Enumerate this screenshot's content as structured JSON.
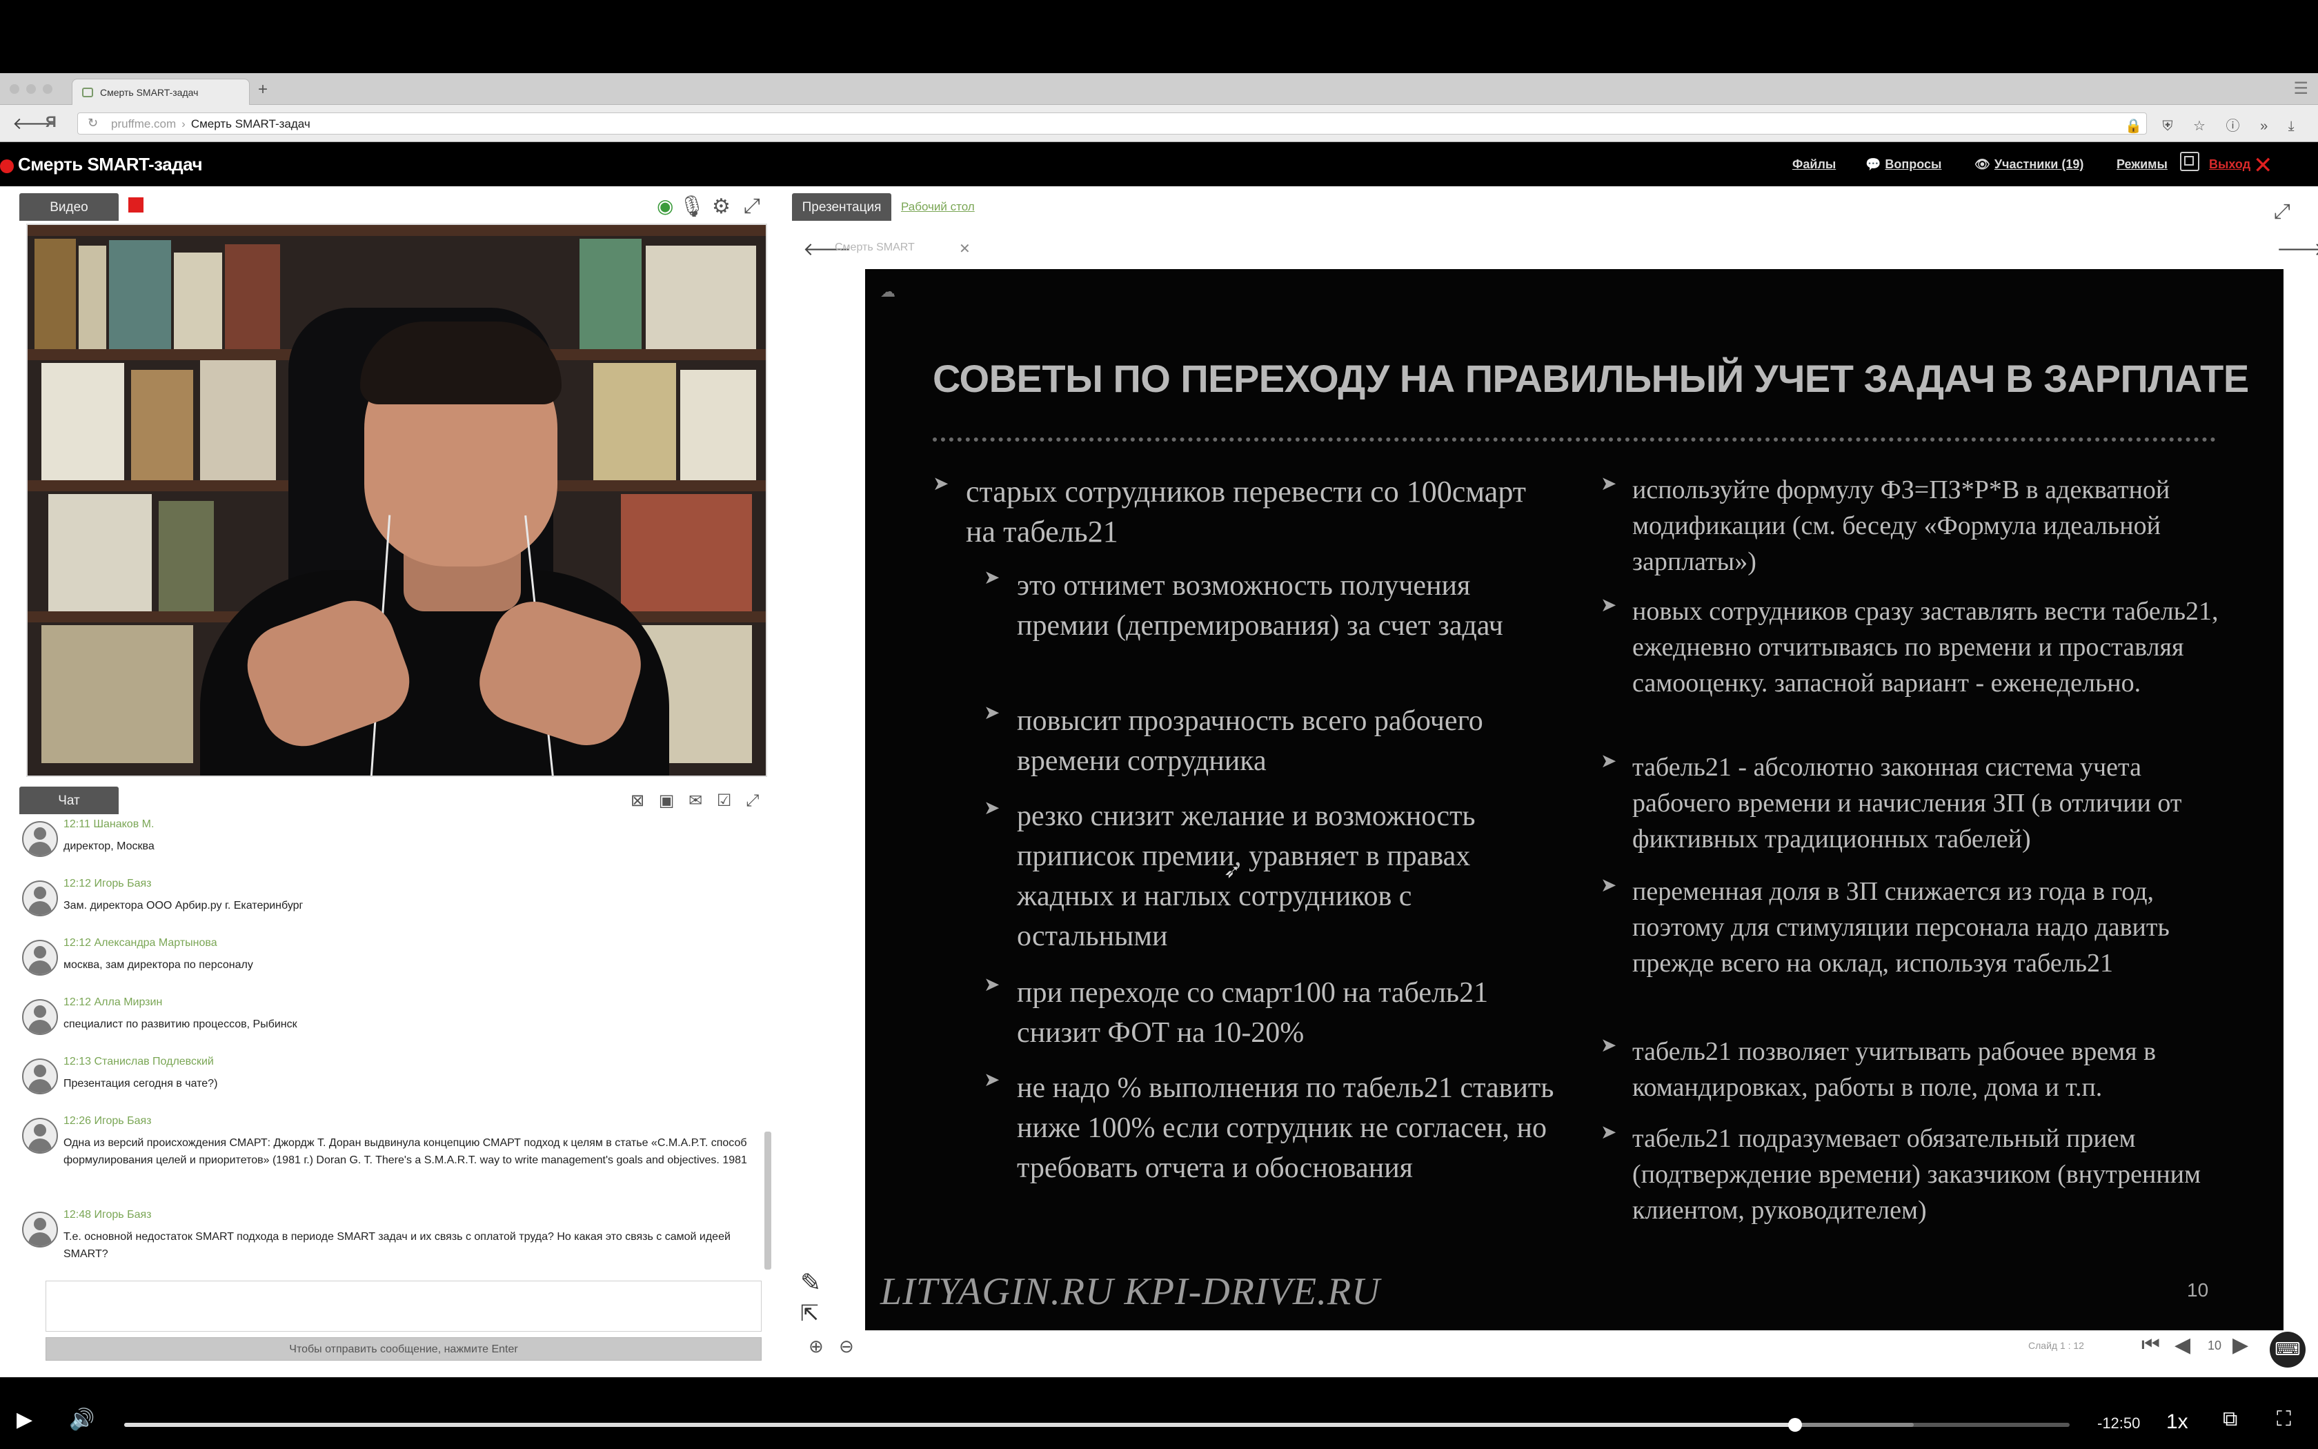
{
  "browser": {
    "tab_title": "Смерть SMART-задач",
    "new_tab_label": "+",
    "domain": "pruffme.com",
    "breadcrumb_sep": "›",
    "page_path": "Смерть SMART-задач"
  },
  "app": {
    "title": "Смерть SMART-задач",
    "nav": {
      "files": "Файлы",
      "questions": "Вопросы",
      "participants": "Участники (19)",
      "modes": "Режимы",
      "exit": "Выход"
    }
  },
  "video_panel": {
    "tab_label": "Видео"
  },
  "chat_panel": {
    "tab_label": "Чат",
    "send_hint": "Чтобы отправить сообщение, нажмите Enter",
    "messages": [
      {
        "time": "12:11",
        "author": "Шанаков М.",
        "text": "директор, Москва"
      },
      {
        "time": "12:12",
        "author": "Игорь Баяз",
        "text": "Зам. директора ООО Арбир.ру г. Екатеринбург"
      },
      {
        "time": "12:12",
        "author": "Александра Мартынова",
        "text": "москва, зам директора по персоналу"
      },
      {
        "time": "12:12",
        "author": "Алла Мирзин",
        "text": "специалист по развитию процессов, Рыбинск"
      },
      {
        "time": "12:13",
        "author": "Станислав Подлевский",
        "text": "Презентация сегодня в чате?)"
      },
      {
        "time": "12:26",
        "author": "Игорь Баяз",
        "text": "Одна из версий происхождения СМАРТ: Джордж Т. Доран выдвинула концепцию СМАРТ подход к целям в статье «С.М.А.Р.Т. способ формулирования целей и приоритетов» (1981 г.) Doran G. T. There's a S.M.A.R.T. way to write management's goals and objectives. 1981"
      },
      {
        "time": "12:48",
        "author": "Игорь Баяз",
        "text": "Т.е. основной недостаток SMART подхода в периоде SMART задач и их связь с оплатой труда? Но какая это связь с самой идеей SMART?"
      }
    ]
  },
  "presentation_panel": {
    "tab_label": "Презентация",
    "desktop_tab_label": "Рабочий стол",
    "doc_tab": "Смерть SMART",
    "slide_counter_label": "Слайд 1 : 12",
    "current_page": "10",
    "slide": {
      "title": "СОВЕТЫ ПО ПЕРЕХОДУ НА ПРАВИЛЬНЫЙ УЧЕТ ЗАДАЧ В ЗАРПЛАТЕ",
      "left_main": "старых сотрудников перевести со 100смарт на табель21",
      "left_sub": [
        "это отнимет возможность получения премии (депремирования) за счет задач",
        "повысит прозрачность всего рабочего времени сотрудника",
        "резко снизит желание и возможность приписок премии, уравняет в правах жадных и наглых сотрудников с остальными",
        "при переходе со смарт100 на табель21 снизит ФОТ на 10-20%",
        "не надо % выполнения по табель21 ставить ниже 100% если сотрудник не согласен, но требовать отчета и обоснования"
      ],
      "right": [
        "используйте формулу ФЗ=ПЗ*Р*В в адекватной модификации (см. беседу «Формула идеальной зарплаты»)",
        "новых сотрудников сразу заставлять вести табель21, ежедневно отчитываясь по времени и проставляя самооценку. запасной вариант - еженедельно.",
        "табель21 - абсолютно законная система учета рабочего времени и начисления ЗП (в отличии от фиктивных традиционных табелей)",
        "переменная доля в ЗП снижается из года в год, поэтому для стимуляции персонала надо давить прежде всего на  оклад, используя табель21",
        "табель21 позволяет учитывать рабочее время в командировках, работы в поле, дома и т.п.",
        "табель21 подразумевает обязательный прием (подтверждение времени) заказчиком (внутренним клиентом, руководителем)"
      ],
      "footer": "LITYAGIN.RU  KPI-DRIVE.RU",
      "page_number": "10"
    }
  },
  "player": {
    "time_remaining": "-12:50",
    "speed": "1x",
    "progress": 0.859,
    "buffered": 0.92
  }
}
